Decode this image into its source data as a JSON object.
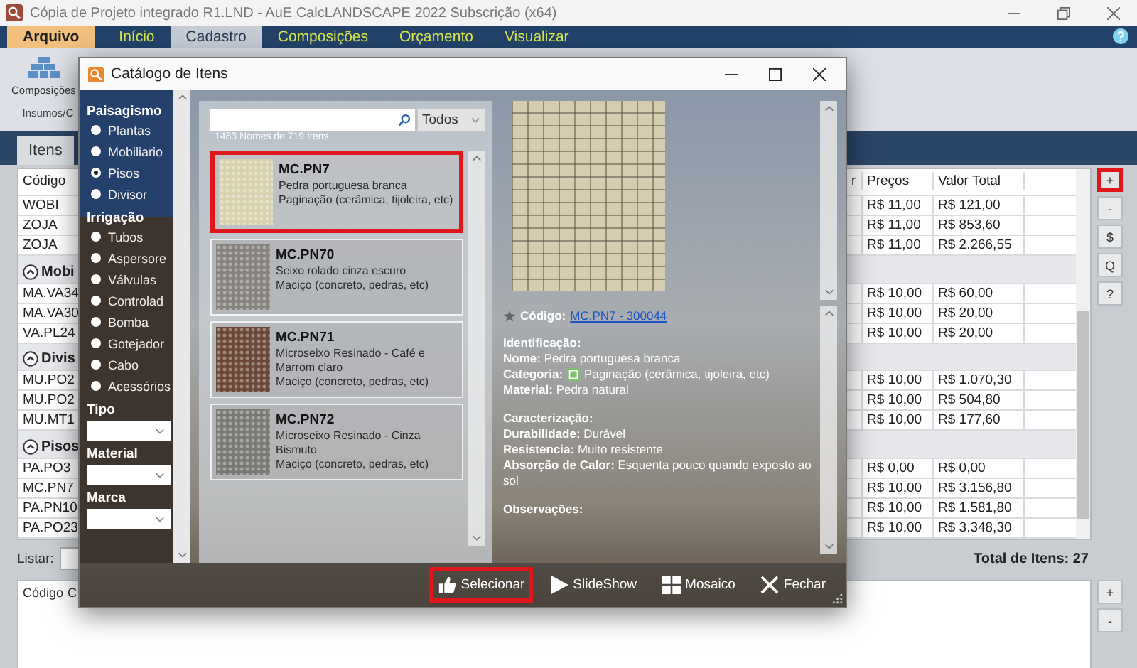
{
  "window": {
    "title": "Cópia de Projeto integrado R1.LND - AuE CalcLANDSCAPE 2022 Subscrição (x64)"
  },
  "menu": [
    {
      "label": "Arquivo",
      "kind": "file",
      "selected": false
    },
    {
      "label": "Início",
      "kind": "tab",
      "selected": false
    },
    {
      "label": "Cadastro",
      "kind": "tab",
      "selected": true
    },
    {
      "label": "Composições",
      "kind": "tab",
      "selected": false
    },
    {
      "label": "Orçamento",
      "kind": "tab",
      "selected": false
    },
    {
      "label": "Visualizar",
      "kind": "tab",
      "selected": false
    }
  ],
  "ribbon": {
    "button": "Composições",
    "group_label": "Insumos/C"
  },
  "tabs": [
    {
      "label": "Itens",
      "selected": true
    }
  ],
  "table": {
    "columns": [
      "Código",
      "r",
      "Preços",
      "Valor Total"
    ],
    "rows": [
      {
        "kind": "item",
        "code": "WOBI",
        "price": "R$ 11,00",
        "total": "R$ 121,00"
      },
      {
        "kind": "item",
        "code": "ZOJA",
        "price": "R$ 11,00",
        "total": "R$ 853,60"
      },
      {
        "kind": "item",
        "code": "ZOJA",
        "price": "R$ 11,00",
        "total": "R$ 2.266,55"
      },
      {
        "kind": "group",
        "label": "Mobi"
      },
      {
        "kind": "item",
        "code": "MA.VA34",
        "price": "R$ 10,00",
        "total": "R$ 60,00"
      },
      {
        "kind": "item",
        "code": "MA.VA30",
        "price": "R$ 10,00",
        "total": "R$ 20,00"
      },
      {
        "kind": "item",
        "code": "VA.PL24",
        "price": "R$ 10,00",
        "total": "R$ 20,00"
      },
      {
        "kind": "group",
        "label": "Divis"
      },
      {
        "kind": "item",
        "code": "MU.PO2",
        "price": "R$ 10,00",
        "total": "R$ 1.070,30"
      },
      {
        "kind": "item",
        "code": "MU.PO2",
        "price": "R$ 10,00",
        "total": "R$ 504,80"
      },
      {
        "kind": "item",
        "code": "MU.MT1",
        "price": "R$ 10,00",
        "total": "R$ 177,60"
      },
      {
        "kind": "group",
        "label": "Pisos"
      },
      {
        "kind": "item",
        "code": "PA.PO3",
        "price": "R$ 0,00",
        "total": "R$ 0,00"
      },
      {
        "kind": "item",
        "code": "MC.PN7",
        "price": "R$ 10,00",
        "total": "R$ 3.156,80"
      },
      {
        "kind": "item",
        "code": "PA.PN10",
        "price": "R$ 10,00",
        "total": "R$ 1.581,80"
      },
      {
        "kind": "item",
        "code": "PA.PO23",
        "price": "R$ 10,00",
        "total": "R$ 3.348,30"
      }
    ]
  },
  "side_buttons": [
    {
      "label": "+",
      "highlighted": true
    },
    {
      "label": "-",
      "highlighted": false
    },
    {
      "label": "$",
      "highlighted": false
    },
    {
      "label": "Q",
      "highlighted": false
    },
    {
      "label": "?",
      "highlighted": false
    }
  ],
  "list_filter": {
    "label": "Listar:"
  },
  "total": "Total de Itens: 27",
  "lower_table": {
    "columns": [
      "Código",
      "C"
    ]
  },
  "lower_buttons": [
    "+",
    "-"
  ],
  "dialog": {
    "title": "Catálogo de Itens",
    "sidebar": {
      "sections": [
        {
          "heading": "Paisagismo",
          "items": [
            {
              "label": "Plantas",
              "selected": false
            },
            {
              "label": "Mobiliario",
              "selected": false
            },
            {
              "label": "Pisos",
              "selected": true
            },
            {
              "label": "Divisor",
              "selected": false
            }
          ]
        },
        {
          "heading": "Irrigação",
          "items": [
            {
              "label": "Tubos",
              "selected": false
            },
            {
              "label": "Aspersore",
              "selected": false
            },
            {
              "label": "Válvulas",
              "selected": false
            },
            {
              "label": "Controlad",
              "selected": false
            },
            {
              "label": "Bomba",
              "selected": false
            },
            {
              "label": "Gotejador",
              "selected": false
            },
            {
              "label": "Cabo",
              "selected": false
            },
            {
              "label": "Acessórios",
              "selected": false
            }
          ]
        }
      ],
      "filters": [
        "Tipo",
        "Material",
        "Marca"
      ]
    },
    "scope": "Todos",
    "count": "1483 Nomes de 719 Itens",
    "items": [
      {
        "code": "MC.PN7",
        "name": "Pedra portuguesa branca",
        "category": "Paginação (cerâmica, tijoleira, etc)",
        "color": "#d8d1ae",
        "selected": true
      },
      {
        "code": "MC.PN70",
        "name": "Seixo rolado cinza escuro",
        "category": "Maciço (concreto, pedras, etc)",
        "color": "#86837e",
        "selected": false
      },
      {
        "code": "MC.PN71",
        "name": "Microseixo Resinado - Café e Marrom claro",
        "category": "Maciço (concreto, pedras, etc)",
        "color": "#6a4838",
        "selected": false
      },
      {
        "code": "MC.PN72",
        "name": "Microseixo Resinado - Cinza Bismuto",
        "category": "Maciço (concreto, pedras, etc)",
        "color": "#7b7975",
        "selected": false
      }
    ],
    "detail": {
      "code_label": "Código:",
      "code_link": "MC.PN7 - 300044",
      "lines": [
        {
          "kind": "heading",
          "text": "Identificação:"
        },
        {
          "kind": "field",
          "text": "**Nome:** Pedra portuguesa branca"
        },
        {
          "kind": "category",
          "label": "Categoria:",
          "text": "Paginação (cerâmica, tijoleira, etc)"
        },
        {
          "kind": "field",
          "text": "**Material:** Pedra natural"
        },
        {
          "kind": "heading",
          "text": "Caracterização:"
        },
        {
          "kind": "field",
          "text": "**Durabilidade:** Durável"
        },
        {
          "kind": "field",
          "text": "**Resistencia:** Muito resistente"
        },
        {
          "kind": "field",
          "text": "**Absorção de Calor:** Esquenta pouco quando exposto ao sol"
        },
        {
          "kind": "heading",
          "text": "Observações:"
        }
      ]
    },
    "actions": [
      {
        "label": "Selecionar",
        "kind": "select",
        "highlighted": true
      },
      {
        "label": "SlideShow",
        "kind": "play",
        "highlighted": false
      },
      {
        "label": "Mosaico",
        "kind": "grid",
        "highlighted": false
      },
      {
        "label": "Fechar",
        "kind": "close",
        "highlighted": false
      }
    ]
  }
}
